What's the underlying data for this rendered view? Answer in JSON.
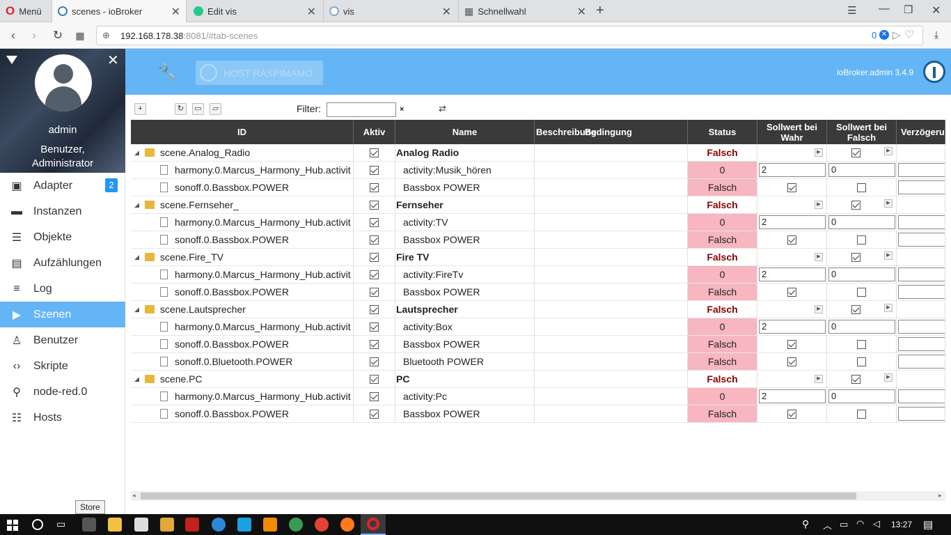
{
  "browser": {
    "tabs": [
      {
        "label": "Menü"
      },
      {
        "label": "scenes - ioBroker"
      },
      {
        "label": "Edit vis"
      },
      {
        "label": "vis"
      },
      {
        "label": "Schnellwahl"
      }
    ],
    "new_tab": "+",
    "url_host": "192.168.178.38",
    "url_rest": ":8081/#tab-scenes",
    "badge_count": "0"
  },
  "sidebar": {
    "user_name": "admin",
    "user_role_line1": "Benutzer,",
    "user_role_line2": "Administrator",
    "items": [
      {
        "label": "Adapter",
        "icon": "store-icon",
        "badge": "2"
      },
      {
        "label": "Instanzen",
        "icon": "instances-icon"
      },
      {
        "label": "Objekte",
        "icon": "list-icon"
      },
      {
        "label": "Aufzählungen",
        "icon": "enum-icon"
      },
      {
        "label": "Log",
        "icon": "log-icon"
      },
      {
        "label": "Szenen",
        "icon": "scene-icon",
        "active": true
      },
      {
        "label": "Benutzer",
        "icon": "user-icon"
      },
      {
        "label": "Skripte",
        "icon": "code-icon"
      },
      {
        "label": "node-red.0",
        "icon": "node-red-icon"
      },
      {
        "label": "Hosts",
        "icon": "hosts-icon"
      }
    ]
  },
  "header": {
    "host_label": "HOST RASPIMAMO",
    "version": "ioBroker.admin 3.4.9"
  },
  "toolbar": {
    "filter_label": "Filter:",
    "filter_value": "",
    "clear": "×"
  },
  "table": {
    "columns": [
      "ID",
      "Aktiv",
      "Name",
      "Beschreibung",
      "Bedingung",
      "Status",
      "Sollwert bei Wahr",
      "Sollwert bei Falsch",
      "Verzögeru"
    ],
    "rows": [
      {
        "kind": "scene",
        "id": "scene.Analog_Radio",
        "aktiv": true,
        "name": "Analog Radio",
        "status": "Falsch",
        "true_val": "",
        "false_val": true
      },
      {
        "kind": "member",
        "id": "harmony.0.Marcus_Harmony_Hub.activit",
        "aktiv": true,
        "name": "activity:Musik_hören",
        "status": "0",
        "true_val": "2",
        "false_val": "0"
      },
      {
        "kind": "member-bool",
        "id": "sonoff.0.Bassbox.POWER",
        "aktiv": true,
        "name": "Bassbox POWER",
        "status": "Falsch",
        "true_val": true,
        "false_val": false
      },
      {
        "kind": "scene",
        "id": "scene.Fernseher_",
        "aktiv": true,
        "name": "Fernseher",
        "status": "Falsch",
        "true_val": "",
        "false_val": true
      },
      {
        "kind": "member",
        "id": "harmony.0.Marcus_Harmony_Hub.activit",
        "aktiv": true,
        "name": "activity:TV",
        "status": "0",
        "true_val": "2",
        "false_val": "0"
      },
      {
        "kind": "member-bool",
        "id": "sonoff.0.Bassbox.POWER",
        "aktiv": true,
        "name": "Bassbox POWER",
        "status": "Falsch",
        "true_val": true,
        "false_val": false
      },
      {
        "kind": "scene",
        "id": "scene.Fire_TV",
        "aktiv": true,
        "name": "Fire TV",
        "status": "Falsch",
        "true_val": "",
        "false_val": true
      },
      {
        "kind": "member",
        "id": "harmony.0.Marcus_Harmony_Hub.activit",
        "aktiv": true,
        "name": "activity:FireTv",
        "status": "0",
        "true_val": "2",
        "false_val": "0"
      },
      {
        "kind": "member-bool",
        "id": "sonoff.0.Bassbox.POWER",
        "aktiv": true,
        "name": "Bassbox POWER",
        "status": "Falsch",
        "true_val": true,
        "false_val": false
      },
      {
        "kind": "scene",
        "id": "scene.Lautsprecher",
        "aktiv": true,
        "name": "Lautsprecher",
        "status": "Falsch",
        "true_val": "",
        "false_val": true
      },
      {
        "kind": "member",
        "id": "harmony.0.Marcus_Harmony_Hub.activit",
        "aktiv": true,
        "name": "activity:Box",
        "status": "0",
        "true_val": "2",
        "false_val": "0"
      },
      {
        "kind": "member-bool",
        "id": "sonoff.0.Bassbox.POWER",
        "aktiv": true,
        "name": "Bassbox POWER",
        "status": "Falsch",
        "true_val": true,
        "false_val": false
      },
      {
        "kind": "member-bool",
        "id": "sonoff.0.Bluetooth.POWER",
        "aktiv": true,
        "name": "Bluetooth POWER",
        "status": "Falsch",
        "true_val": true,
        "false_val": false
      },
      {
        "kind": "scene",
        "id": "scene.PC",
        "aktiv": true,
        "name": "PC",
        "status": "Falsch",
        "true_val": "",
        "false_val": true
      },
      {
        "kind": "member",
        "id": "harmony.0.Marcus_Harmony_Hub.activit",
        "aktiv": true,
        "name": "activity:Pc",
        "status": "0",
        "true_val": "2",
        "false_val": "0"
      },
      {
        "kind": "member-bool",
        "id": "sonoff.0.Bassbox.POWER",
        "aktiv": true,
        "name": "Bassbox POWER",
        "status": "Falsch",
        "true_val": true,
        "false_val": false
      }
    ]
  },
  "taskbar": {
    "time": "13:27",
    "tooltip": "Store"
  },
  "colors": {
    "header_blue": "#64b5f6",
    "status_pink": "#f7b6c0",
    "status_red_text": "#8b0000"
  }
}
